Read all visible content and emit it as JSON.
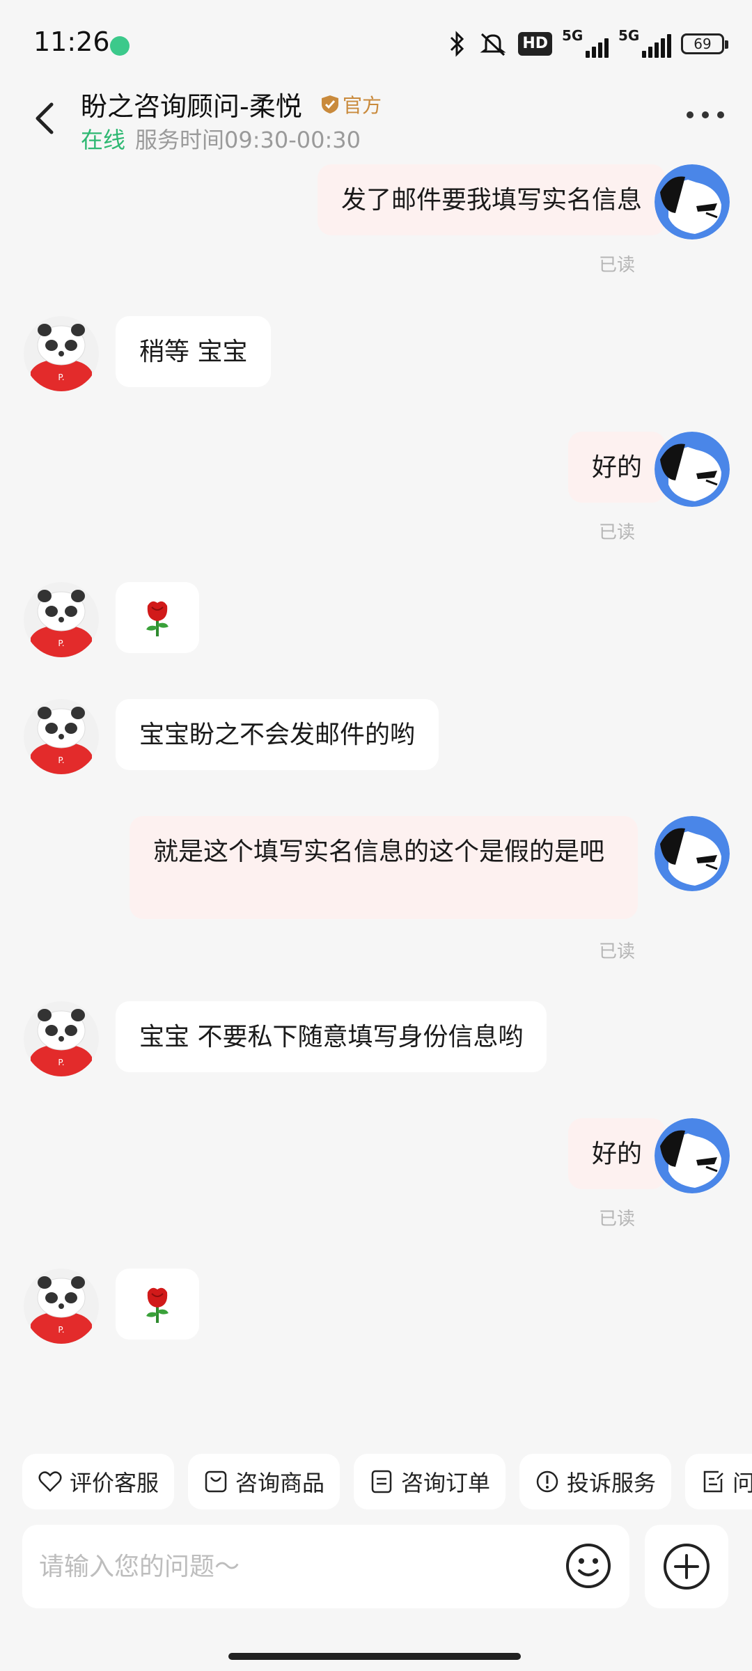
{
  "status_bar": {
    "time": "11:26",
    "hd_label": "HD",
    "net1": "5G",
    "net2": "5G",
    "battery": "69"
  },
  "header": {
    "title": "盼之咨询顾问-柔悦",
    "official": "官方",
    "online": "在线",
    "service_time": "服务时间09:30-00:30"
  },
  "messages": [
    {
      "side": "me",
      "text": "发了邮件要我填写实名信息",
      "status": "已读"
    },
    {
      "side": "them",
      "text": "稍等 宝宝"
    },
    {
      "side": "me",
      "text": "好的",
      "status": "已读"
    },
    {
      "side": "them",
      "emoji": "rose"
    },
    {
      "side": "them",
      "text": "宝宝盼之不会发邮件的哟"
    },
    {
      "side": "me",
      "text": "就是这个填写实名信息的这个是假的是吧",
      "status": "已读"
    },
    {
      "side": "them",
      "text": "宝宝 不要私下随意填写身份信息哟"
    },
    {
      "side": "me",
      "text": "好的",
      "status": "已读"
    },
    {
      "side": "them",
      "emoji": "rose"
    }
  ],
  "quick_actions": [
    "评价客服",
    "咨询商品",
    "咨询订单",
    "投诉服务",
    "问"
  ],
  "input": {
    "placeholder": "请输入您的问题～"
  },
  "colors": {
    "accent_green": "#2eb872",
    "official_gold": "#c98a3c",
    "bubble_me": "#fdf1f0",
    "bubble_them": "#ffffff"
  }
}
